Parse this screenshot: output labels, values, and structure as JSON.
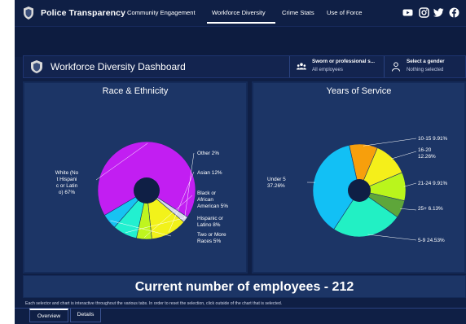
{
  "nav": {
    "brand": "Police Transparency",
    "items": [
      "Community Engagement",
      "Workforce Diversity",
      "Crime Stats",
      "Use of Force"
    ],
    "active": "Workforce Diversity",
    "social_icons": [
      "youtube-icon",
      "instagram-icon",
      "twitter-icon",
      "facebook-icon"
    ]
  },
  "header": {
    "title": "Workforce Diversity Dashboard",
    "selector1": {
      "title": "Sworn or professional s...",
      "value": "All employees"
    },
    "selector2": {
      "title": "Select a gender",
      "value": "Nothing selected"
    }
  },
  "chart_data": [
    {
      "type": "pie",
      "title": "Race & Ethnicity",
      "slices": [
        {
          "label": "White (Not Hispanic or Latino) 67%",
          "value": 67,
          "color": "#c21ef2"
        },
        {
          "label": "Other 2%",
          "value": 2,
          "color": "#d8d8ea"
        },
        {
          "label": "Asian 12%",
          "value": 12,
          "color": "#f2f21a"
        },
        {
          "label": "Black or African American 5%",
          "value": 5,
          "color": "#bff51f"
        },
        {
          "label": "Hispanic or Latino 8%",
          "value": 8,
          "color": "#22f0d0"
        },
        {
          "label": "Two or More Races 5%",
          "value": 5,
          "color": "#17c3f2"
        }
      ]
    },
    {
      "type": "pie",
      "title": "Years of Service",
      "slices": [
        {
          "label": "10-15 9.91%",
          "value": 9.91,
          "color": "#f79f0c"
        },
        {
          "label": "16-20 12.26%",
          "value": 12.26,
          "color": "#f5ef1a"
        },
        {
          "label": "21-24 9.91%",
          "value": 9.91,
          "color": "#baf51c"
        },
        {
          "label": "25+ 6.13%",
          "value": 6.13,
          "color": "#5ea63a"
        },
        {
          "label": "5-9 24.53%",
          "value": 24.53,
          "color": "#22f0c4"
        },
        {
          "label": "Under 5 37.26%",
          "value": 37.26,
          "color": "#12c0f5"
        }
      ]
    }
  ],
  "footer": {
    "count": "Current number of employees - 212",
    "note": "Each selector and chart is interactive throughout the various tabs. In order to reset the selection, click outside of the chart that is selected.",
    "tabs": [
      "Overview",
      "Details"
    ]
  }
}
